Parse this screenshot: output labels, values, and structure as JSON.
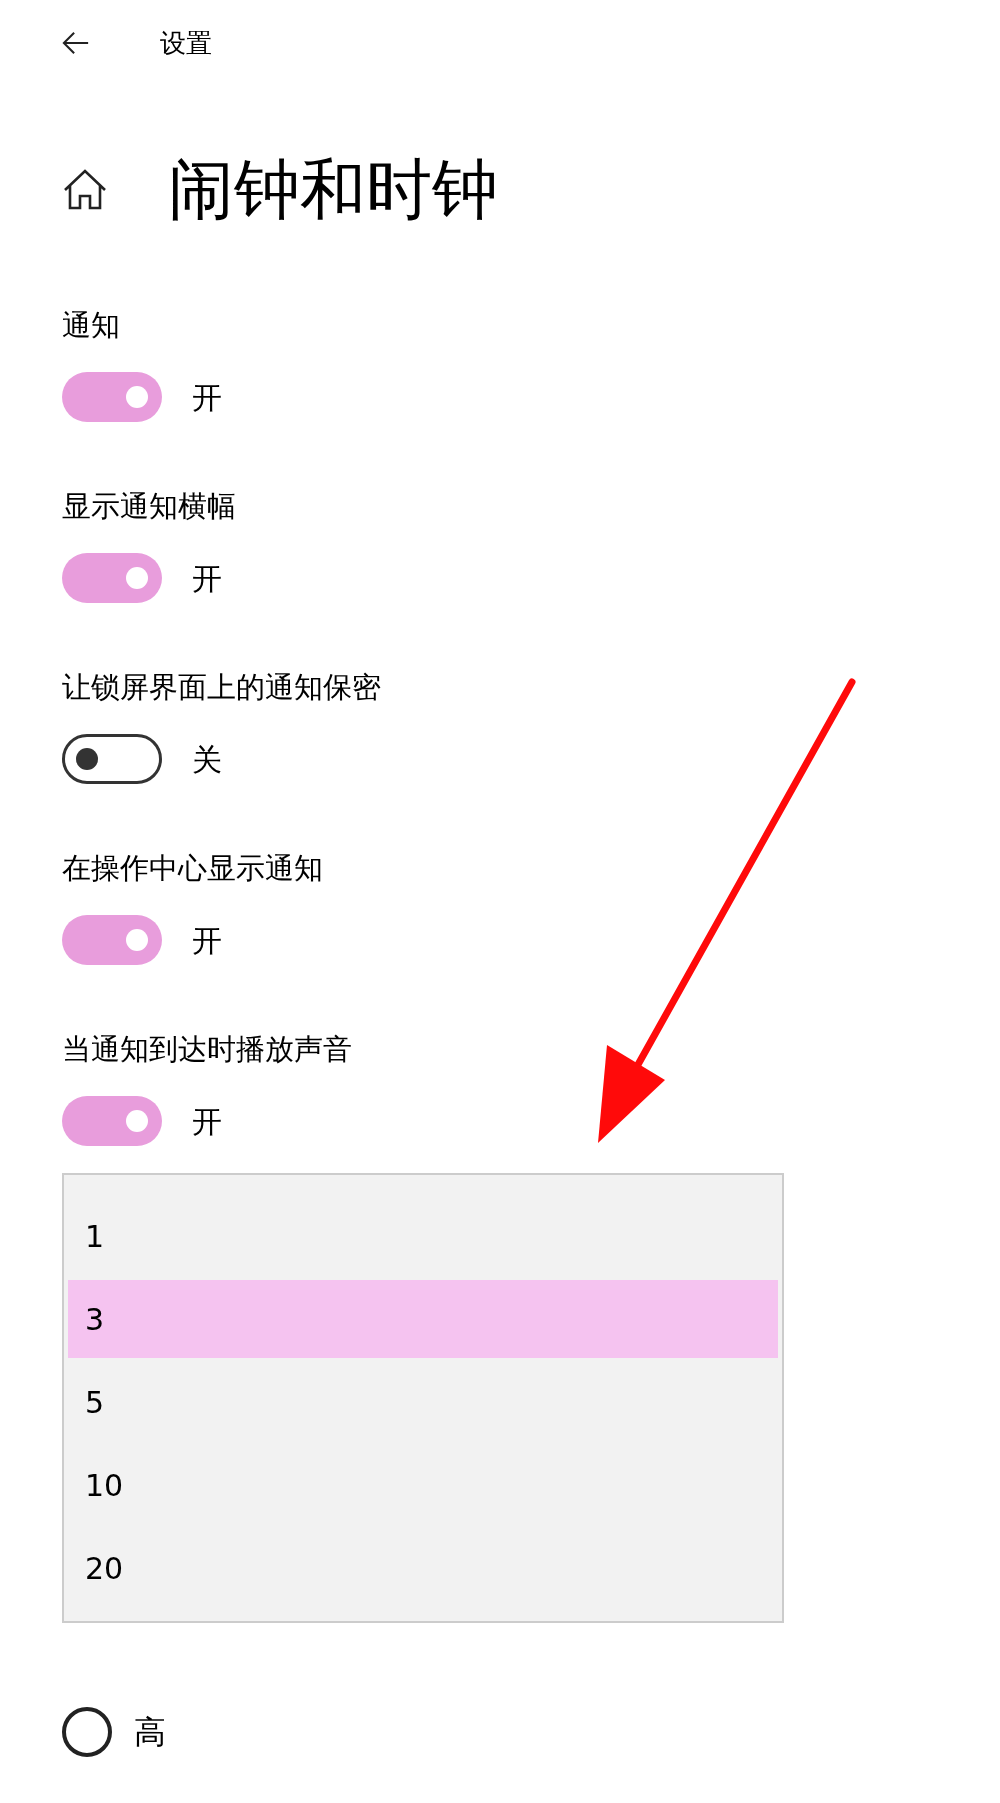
{
  "header": {
    "title": "设置"
  },
  "page": {
    "title": "闹钟和时钟"
  },
  "settings": [
    {
      "label": "通知",
      "on": true,
      "state_text": "开"
    },
    {
      "label": "显示通知横幅",
      "on": true,
      "state_text": "开"
    },
    {
      "label": "让锁屏界面上的通知保密",
      "on": false,
      "state_text": "关"
    },
    {
      "label": "在操作中心显示通知",
      "on": true,
      "state_text": "开"
    },
    {
      "label": "当通知到达时播放声音",
      "on": true,
      "state_text": "开"
    }
  ],
  "dropdown": {
    "items": [
      {
        "label": "1",
        "selected": false
      },
      {
        "label": "3",
        "selected": true
      },
      {
        "label": "5",
        "selected": false
      },
      {
        "label": "10",
        "selected": false
      },
      {
        "label": "20",
        "selected": false
      }
    ]
  },
  "priority": {
    "options": [
      {
        "label": "高",
        "selected": false
      }
    ]
  }
}
